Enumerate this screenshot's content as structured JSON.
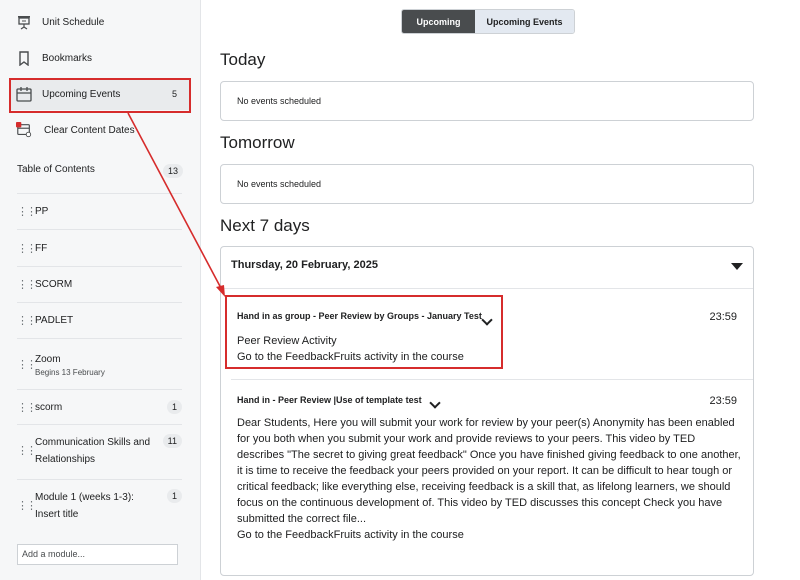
{
  "sidebar": {
    "items": [
      {
        "label": "Unit Schedule",
        "icon": "presentation-icon"
      },
      {
        "label": "Bookmarks",
        "icon": "bookmark-icon"
      },
      {
        "label": "Upcoming Events",
        "icon": "calendar-icon",
        "count": "5"
      },
      {
        "label": "Clear Content Dates",
        "icon": "calendar-clear-icon"
      }
    ],
    "toc_label": "Table of Contents",
    "toc_count": "13",
    "modules": [
      {
        "label": "PP"
      },
      {
        "label": "FF"
      },
      {
        "label": "SCORM"
      },
      {
        "label": "PADLET"
      },
      {
        "label": "Zoom",
        "sub": "Begins 13 February"
      },
      {
        "label": "scorm",
        "count": "1"
      },
      {
        "label": "Communication Skills and Relationships",
        "count": "11"
      },
      {
        "label": "Module 1 (weeks 1-3): Insert title",
        "count": "1"
      }
    ],
    "add_module_placeholder": "Add a module..."
  },
  "toggle": {
    "active": "Upcoming",
    "inactive": "Upcoming Events"
  },
  "sections": {
    "today": {
      "title": "Today",
      "empty": "No events scheduled"
    },
    "tomorrow": {
      "title": "Tomorrow",
      "empty": "No events scheduled"
    },
    "week": {
      "title": "Next 7 days",
      "date": "Thursday, 20 February, 2025"
    }
  },
  "events": [
    {
      "title": "Hand in as group - Peer Review by Groups - January Test",
      "time": "23:59",
      "line1": "Peer Review Activity",
      "line2": "Go to the FeedbackFruits activity in the course"
    },
    {
      "title": "Hand in - Peer Review |Use of template test",
      "time": "23:59",
      "description": [
        "Dear Students, Here you will submit your work for review by your peer(s) Anonymity has been enabled",
        "for you both when you submit your work and provide reviews to your peers. This video by TED",
        "describes \"The secret to giving great feedback\" Once you have finished giving feedback to one another,",
        "it is time to receive the feedback your peers provided on your report. It can be difficult to hear tough or",
        "critical feedback; like everything else, receiving feedback is a skill that, as lifelong learners, we should",
        "focus on the continuous development of. This video by TED discusses this concept Check you have",
        "submitted the correct file..."
      ],
      "link": "Go to the FeedbackFruits activity in the course"
    }
  ],
  "colors": {
    "highlight": "#d62c2c",
    "toggle_active": "#494c4e",
    "toggle_inactive": "#e3e9f1"
  }
}
